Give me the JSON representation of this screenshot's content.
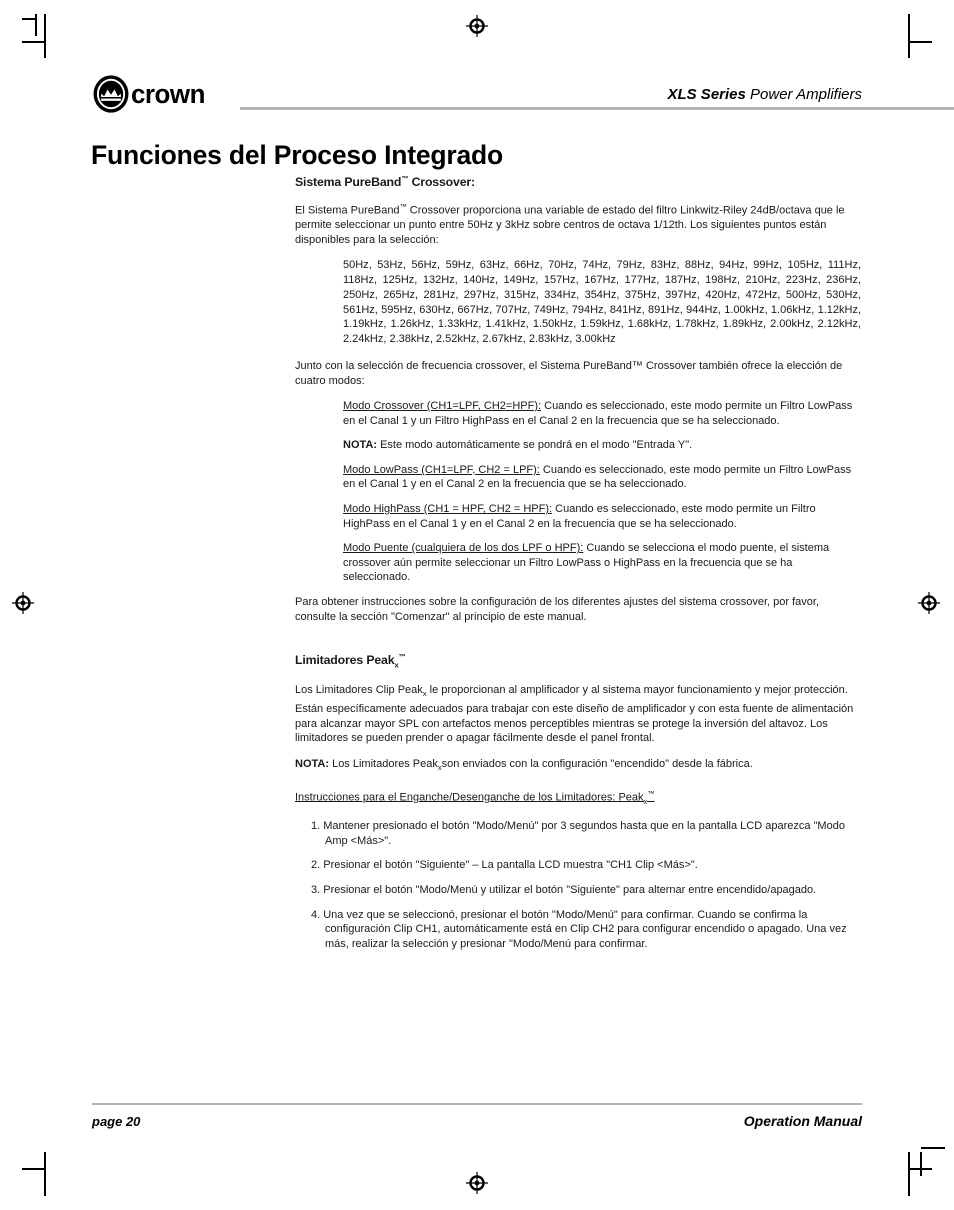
{
  "header": {
    "logo_word": "crown",
    "title_bold": "XLS Series",
    "title_rest": " Power Amplifiers"
  },
  "page_heading": "Funciones del Proceso Integrado",
  "crossover": {
    "heading_pre": "Sistema PureBand",
    "heading_tm": "™",
    "heading_post": " Crossover:",
    "intro_a": "El Sistema PureBand",
    "intro_tm": "™",
    "intro_b": " Crossover proporciona una variable de estado del filtro Linkwitz-Riley 24dB/octava que le permite seleccionar un punto entre 50Hz y 3kHz sobre centros de octava 1/12th. Los siguientes puntos están disponibles para la selección:",
    "frequencies": "50Hz, 53Hz, 56Hz, 59Hz, 63Hz, 66Hz, 70Hz, 74Hz, 79Hz, 83Hz, 88Hz, 94Hz, 99Hz, 105Hz, 111Hz, 118Hz, 125Hz, 132Hz, 140Hz, 149Hz, 157Hz, 167Hz, 177Hz, 187Hz, 198Hz, 210Hz, 223Hz, 236Hz, 250Hz, 265Hz, 281Hz, 297Hz, 315Hz, 334Hz, 354Hz, 375Hz, 397Hz, 420Hz, 472Hz, 500Hz, 530Hz, 561Hz, 595Hz, 630Hz, 667Hz, 707Hz, 749Hz, 794Hz, 841Hz, 891Hz, 944Hz, 1.00kHz, 1.06kHz, 1.12kHz, 1.19kHz, 1.26kHz, 1.33kHz, 1.41kHz, 1.50kHz, 1.59kHz, 1.68kHz, 1.78kHz, 1.89kHz, 2.00kHz, 2.12kHz, 2.24kHz, 2.38kHz, 2.52kHz, 2.67kHz, 2.83kHz, 3.00kHz",
    "modes_intro": "Junto con la selección de frecuencia crossover, el Sistema PureBand™ Crossover  también ofrece la elección de cuatro modos:",
    "modes": [
      {
        "label": "Modo Crossover (CH1=LPF, CH2=HPF):",
        "text": " Cuando es seleccionado, este modo permite un Filtro LowPass en el Canal 1 y un Filtro HighPass en el Canal 2 en la frecuencia que se ha seleccionado."
      },
      {
        "label": "Modo LowPass (CH1=LPF, CH2 = LPF):",
        "text": "  Cuando es seleccionado, este modo permite un Filtro LowPass en el Canal 1 y en el Canal 2 en la frecuencia que se ha seleccionado."
      },
      {
        "label": "Modo HighPass (CH1 = HPF, CH2 = HPF):",
        "text": "  Cuando es seleccionado, este modo permite un Filtro HighPass en el Canal 1 y en el Canal 2 en la frecuencia que se ha seleccionado."
      },
      {
        "label": "Modo Puente (cualquiera de los dos LPF o HPF):",
        "text": " Cuando se selecciona el modo puente, el sistema crossover aún permite seleccionar un Filtro LowPass o HighPass en la frecuencia que se ha seleccionado."
      }
    ],
    "note_label": "NOTA:",
    "note_text": " Este modo automáticamente se pondrá en el modo \"Entrada Y\".",
    "closing": "Para obtener instrucciones sobre la configuración de los diferentes ajustes del sistema crossover, por favor, consulte la sección \"Comenzar\" al principio  de este manual."
  },
  "limiters": {
    "heading_pre": "Limitadores Peak",
    "heading_sub": "x",
    "heading_tm": "™",
    "para_a": "Los Limitadores Clip Peak",
    "para_sub": "x",
    "para_b": " le proporcionan al amplificador y al sistema mayor funcionamiento y mejor protección. Están específicamente adecuados para trabajar con este diseño de amplificador y con esta fuente de alimentación para alcanzar mayor SPL con artefactos menos perceptibles mientras se protege la inversión del altavoz.  Los limitadores se pueden prender o apagar fácilmente desde el panel frontal.",
    "note_label": "NOTA:",
    "note_a": " Los Limitadores Peak",
    "note_sub": "x",
    "note_b": "son enviados con la configuración \"encendido\" desde la fábrica.",
    "instr_head_a": "Instrucciones para el Enganche/Desenganche de los Limitadores: Peak",
    "instr_head_sub": "x",
    "instr_head_tm": "™",
    "steps": [
      "1. Mantener presionado el botón \"Modo/Menú\" por 3 segundos hasta que en la pantalla LCD aparezca \"Modo Amp <Más>\".",
      "2. Presionar el botón \"Siguiente\" – La pantalla LCD muestra \"CH1 Clip <Más>\".",
      "3. Presionar el botón \"Modo/Menú y utilizar el botón \"Siguiente\" para alternar entre encendido/apagado.",
      "4. Una vez que se seleccionó, presionar el botón \"Modo/Menú\" para confirmar.  Cuando se confirma la configuración Clip CH1, automáticamente está en Clip CH2 para configurar encendido o apagado. Una vez más, realizar la selección y presionar \"Modo/Menú para confirmar."
    ]
  },
  "footer": {
    "page_label": "page 20",
    "manual_label": "Operation Manual"
  },
  "colors": {
    "rule": "#b3b3b3",
    "text": "#1a1a1a"
  }
}
